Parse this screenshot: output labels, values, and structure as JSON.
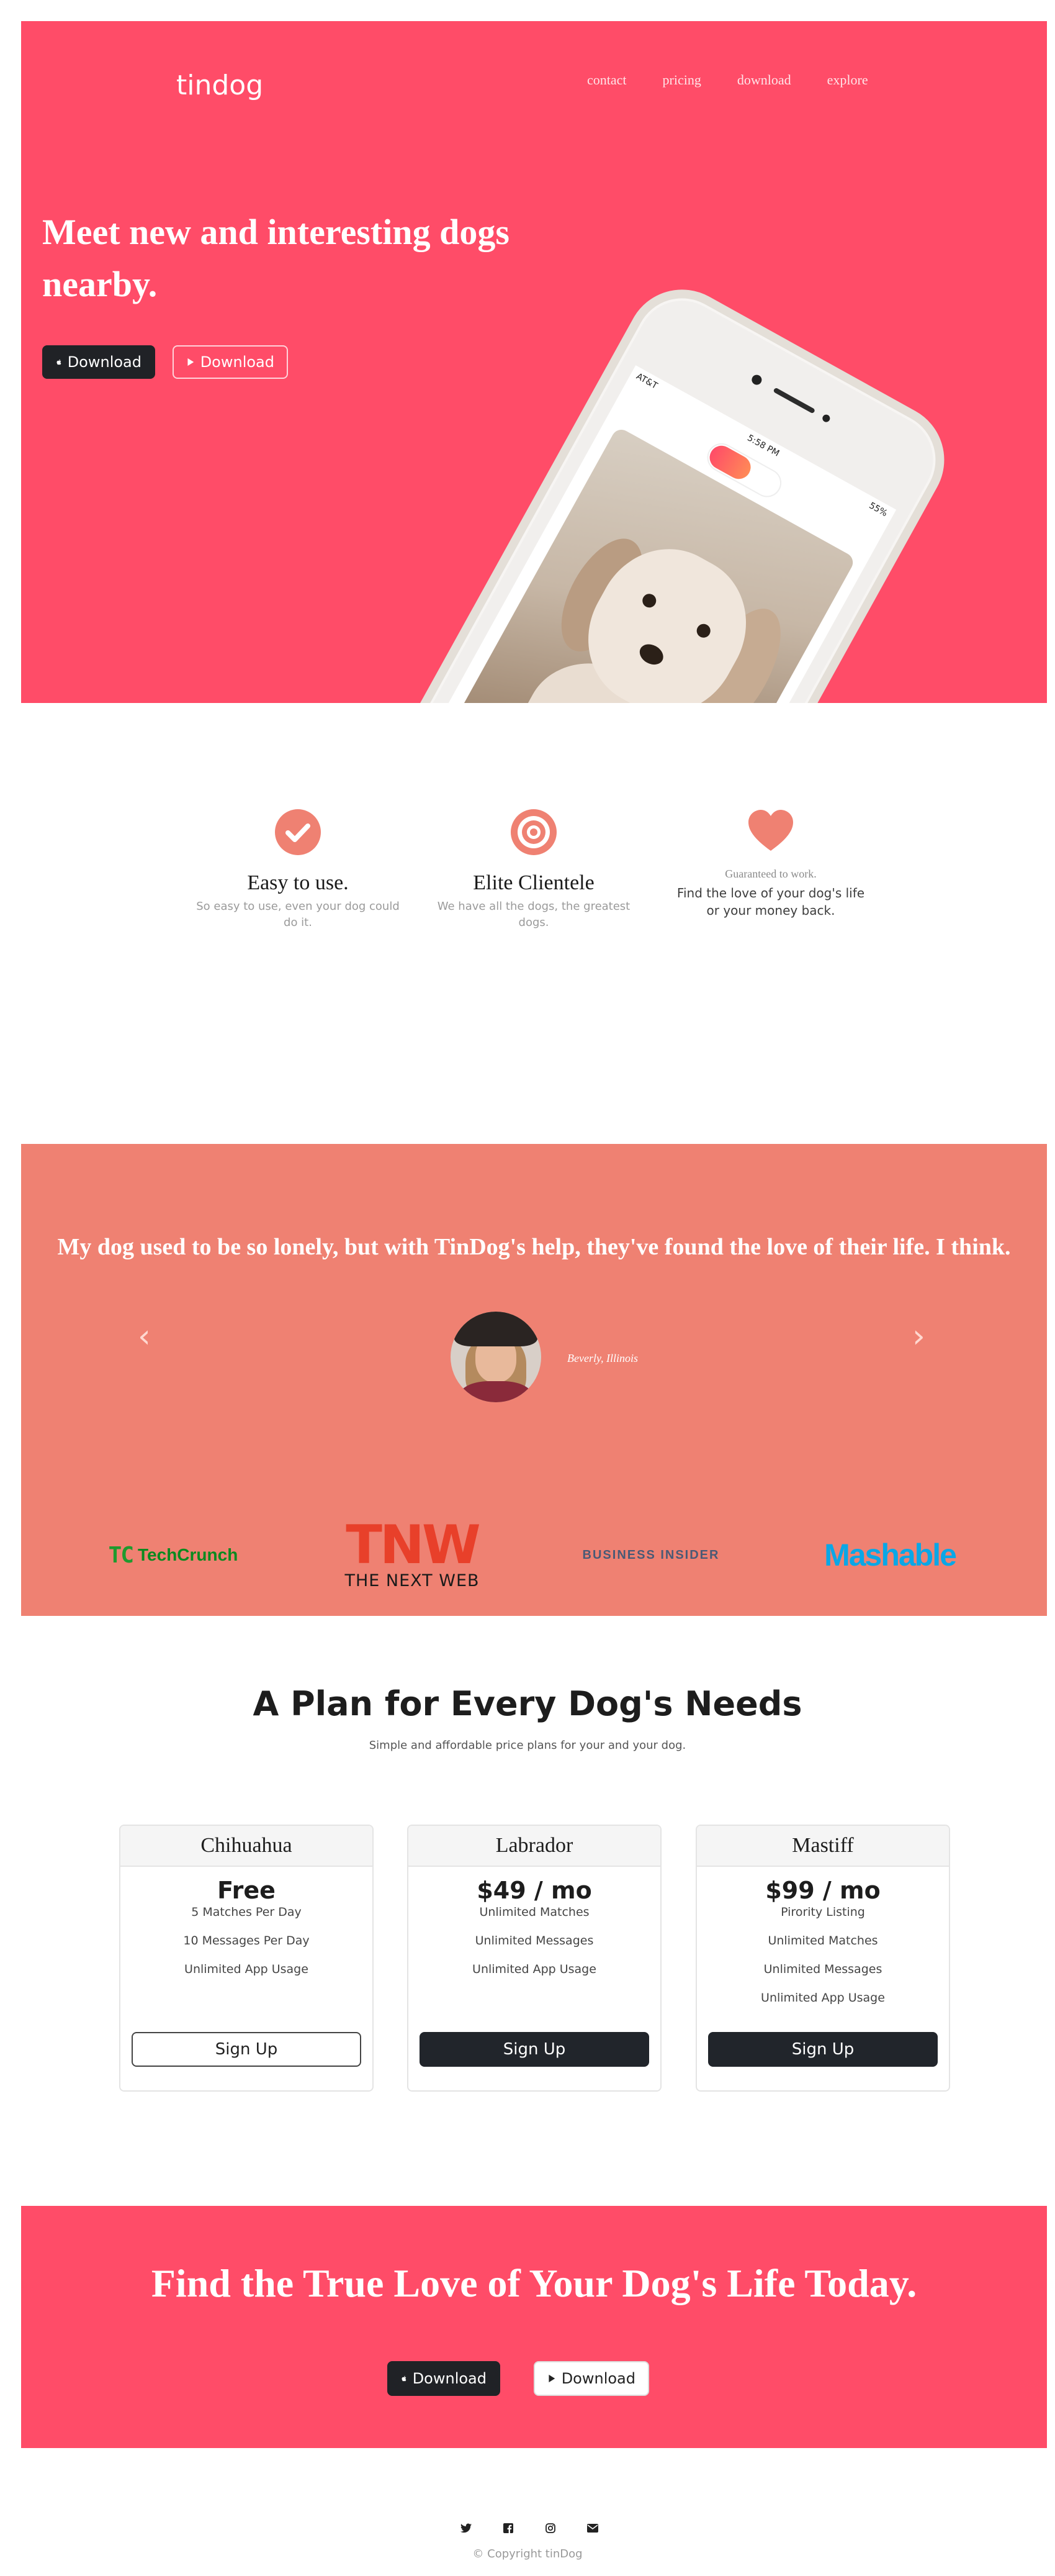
{
  "brand": "tindog",
  "nav": [
    "contact",
    "pricing",
    "download",
    "explore"
  ],
  "hero": {
    "title": "Meet new and interesting dogs nearby.",
    "apple_download": "Download",
    "play_download": "Download",
    "phone_status_left": "AT&T",
    "phone_time": "5:58 PM",
    "phone_battery": "55%"
  },
  "features": [
    {
      "icon": "check-circle-icon",
      "title": "Easy to use.",
      "text": "So easy to use, even your dog could do it."
    },
    {
      "icon": "bullseye-icon",
      "title": "Elite Clientele",
      "text": "We have all the dogs, the greatest dogs."
    },
    {
      "icon": "heart-icon",
      "title": "Guaranteed to work.",
      "text": "Find the love of your dog's life or your money back."
    }
  ],
  "testimonial": {
    "quote": "My dog used to be so lonely, but with TinDog's help, they've found the love of their life. I think.",
    "author": "Beverly, Illinois"
  },
  "press": [
    "TechCrunch",
    "TNW",
    "THE NEXT WEB",
    "BUSINESS INSIDER",
    "Mashable"
  ],
  "pricing": {
    "title": "A Plan for Every Dog's Needs",
    "subtitle": "Simple and affordable price plans for your and your dog.",
    "plans": [
      {
        "name": "Chihuahua",
        "price": "Free",
        "features": [
          "5 Matches Per Day",
          "10 Messages Per Day",
          "Unlimited App Usage"
        ],
        "cta": "Sign Up"
      },
      {
        "name": "Labrador",
        "price": "$49 / mo",
        "features": [
          "Unlimited Matches",
          "Unlimited Messages",
          "Unlimited App Usage"
        ],
        "cta": "Sign Up"
      },
      {
        "name": "Mastiff",
        "price": "$99 / mo",
        "features": [
          "Pirority Listing",
          "Unlimited Matches",
          "Unlimited Messages",
          "Unlimited App Usage"
        ],
        "cta": "Sign Up"
      }
    ]
  },
  "cta": {
    "title": "Find the True Love of Your Dog's Life Today.",
    "apple_download": "Download",
    "play_download": "Download"
  },
  "footer": {
    "socials": [
      "twitter-icon",
      "facebook-icon",
      "instagram-icon",
      "envelope-icon"
    ],
    "copyright": "© Copyright tinDog"
  },
  "colors": {
    "hero": "#ff4c68",
    "testimonial": "#ef8172",
    "dark": "#21252b",
    "feature_icon": "#ef8172"
  }
}
